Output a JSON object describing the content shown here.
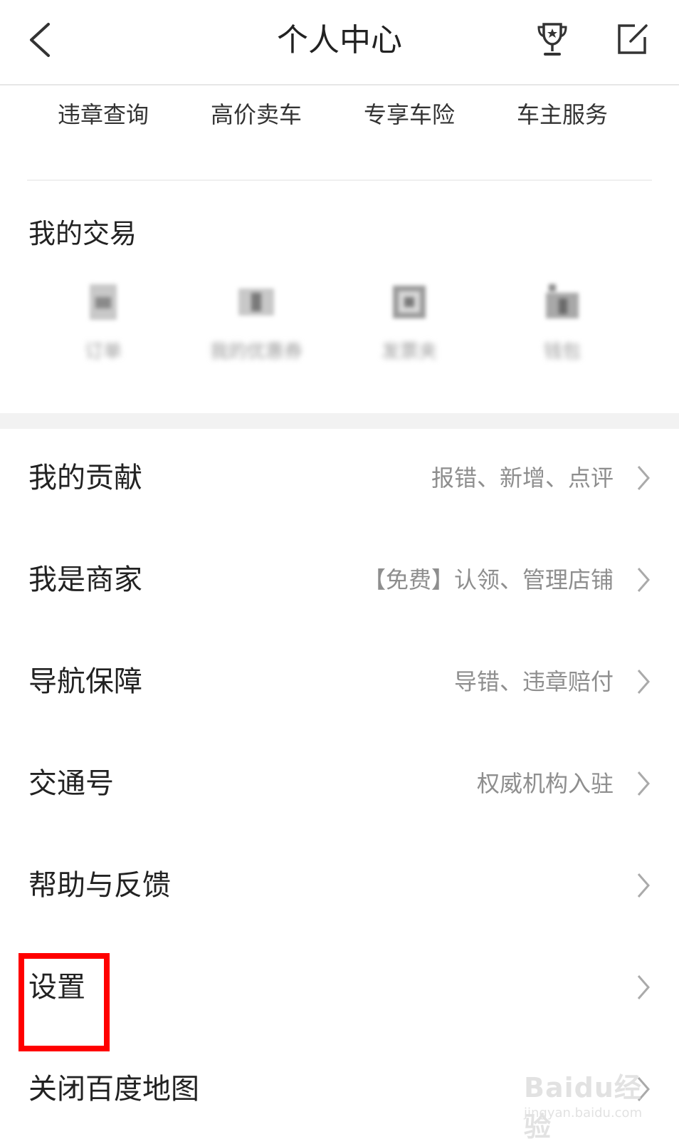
{
  "header": {
    "title": "个人中心"
  },
  "services": [
    "违章查询",
    "高价卖车",
    "专享车险",
    "车主服务"
  ],
  "trade": {
    "title": "我的交易",
    "items": [
      {
        "label": "订单",
        "icon": "order-icon"
      },
      {
        "label": "我的优惠券",
        "icon": "coupon-icon"
      },
      {
        "label": "发票夹",
        "icon": "invoice-icon"
      },
      {
        "label": "钱包",
        "icon": "wallet-icon"
      }
    ]
  },
  "menu": [
    {
      "label": "我的贡献",
      "detail": "报错、新增、点评"
    },
    {
      "label": "我是商家",
      "detail": "【免费】认领、管理店铺"
    },
    {
      "label": "导航保障",
      "detail": "导错、违章赔付"
    },
    {
      "label": "交通号",
      "detail": "权威机构入驻"
    },
    {
      "label": "帮助与反馈",
      "detail": ""
    },
    {
      "label": "设置",
      "detail": ""
    },
    {
      "label": "关闭百度地图",
      "detail": ""
    }
  ],
  "watermark": {
    "logo": "Baidu经验",
    "url": "jingyan.baidu.com"
  },
  "colors": {
    "highlight": "#ff0000",
    "text": "#222222",
    "secondary": "#8e8e8e"
  }
}
